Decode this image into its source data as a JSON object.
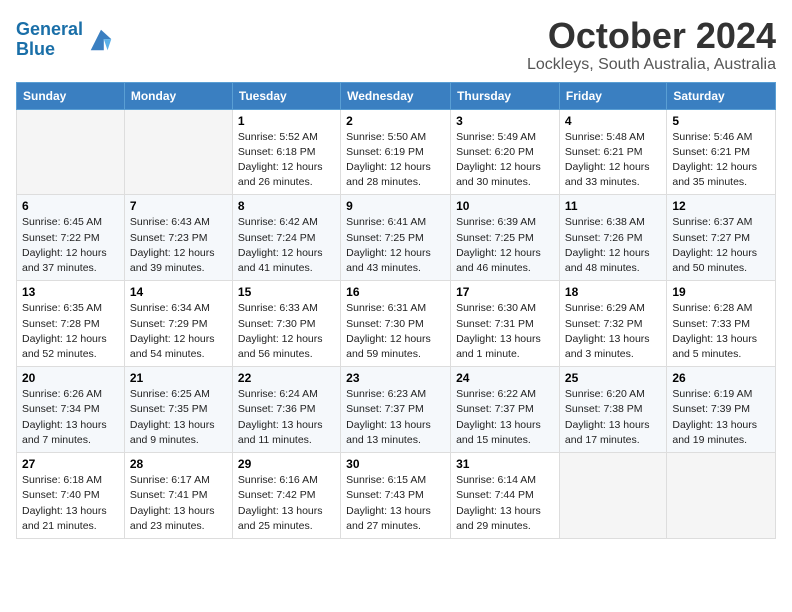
{
  "header": {
    "logo_line1": "General",
    "logo_line2": "Blue",
    "month": "October 2024",
    "location": "Lockleys, South Australia, Australia"
  },
  "days_of_week": [
    "Sunday",
    "Monday",
    "Tuesday",
    "Wednesday",
    "Thursday",
    "Friday",
    "Saturday"
  ],
  "weeks": [
    [
      {
        "day": "",
        "content": ""
      },
      {
        "day": "",
        "content": ""
      },
      {
        "day": "1",
        "content": "Sunrise: 5:52 AM\nSunset: 6:18 PM\nDaylight: 12 hours\nand 26 minutes."
      },
      {
        "day": "2",
        "content": "Sunrise: 5:50 AM\nSunset: 6:19 PM\nDaylight: 12 hours\nand 28 minutes."
      },
      {
        "day": "3",
        "content": "Sunrise: 5:49 AM\nSunset: 6:20 PM\nDaylight: 12 hours\nand 30 minutes."
      },
      {
        "day": "4",
        "content": "Sunrise: 5:48 AM\nSunset: 6:21 PM\nDaylight: 12 hours\nand 33 minutes."
      },
      {
        "day": "5",
        "content": "Sunrise: 5:46 AM\nSunset: 6:21 PM\nDaylight: 12 hours\nand 35 minutes."
      }
    ],
    [
      {
        "day": "6",
        "content": "Sunrise: 6:45 AM\nSunset: 7:22 PM\nDaylight: 12 hours\nand 37 minutes."
      },
      {
        "day": "7",
        "content": "Sunrise: 6:43 AM\nSunset: 7:23 PM\nDaylight: 12 hours\nand 39 minutes."
      },
      {
        "day": "8",
        "content": "Sunrise: 6:42 AM\nSunset: 7:24 PM\nDaylight: 12 hours\nand 41 minutes."
      },
      {
        "day": "9",
        "content": "Sunrise: 6:41 AM\nSunset: 7:25 PM\nDaylight: 12 hours\nand 43 minutes."
      },
      {
        "day": "10",
        "content": "Sunrise: 6:39 AM\nSunset: 7:25 PM\nDaylight: 12 hours\nand 46 minutes."
      },
      {
        "day": "11",
        "content": "Sunrise: 6:38 AM\nSunset: 7:26 PM\nDaylight: 12 hours\nand 48 minutes."
      },
      {
        "day": "12",
        "content": "Sunrise: 6:37 AM\nSunset: 7:27 PM\nDaylight: 12 hours\nand 50 minutes."
      }
    ],
    [
      {
        "day": "13",
        "content": "Sunrise: 6:35 AM\nSunset: 7:28 PM\nDaylight: 12 hours\nand 52 minutes."
      },
      {
        "day": "14",
        "content": "Sunrise: 6:34 AM\nSunset: 7:29 PM\nDaylight: 12 hours\nand 54 minutes."
      },
      {
        "day": "15",
        "content": "Sunrise: 6:33 AM\nSunset: 7:30 PM\nDaylight: 12 hours\nand 56 minutes."
      },
      {
        "day": "16",
        "content": "Sunrise: 6:31 AM\nSunset: 7:30 PM\nDaylight: 12 hours\nand 59 minutes."
      },
      {
        "day": "17",
        "content": "Sunrise: 6:30 AM\nSunset: 7:31 PM\nDaylight: 13 hours\nand 1 minute."
      },
      {
        "day": "18",
        "content": "Sunrise: 6:29 AM\nSunset: 7:32 PM\nDaylight: 13 hours\nand 3 minutes."
      },
      {
        "day": "19",
        "content": "Sunrise: 6:28 AM\nSunset: 7:33 PM\nDaylight: 13 hours\nand 5 minutes."
      }
    ],
    [
      {
        "day": "20",
        "content": "Sunrise: 6:26 AM\nSunset: 7:34 PM\nDaylight: 13 hours\nand 7 minutes."
      },
      {
        "day": "21",
        "content": "Sunrise: 6:25 AM\nSunset: 7:35 PM\nDaylight: 13 hours\nand 9 minutes."
      },
      {
        "day": "22",
        "content": "Sunrise: 6:24 AM\nSunset: 7:36 PM\nDaylight: 13 hours\nand 11 minutes."
      },
      {
        "day": "23",
        "content": "Sunrise: 6:23 AM\nSunset: 7:37 PM\nDaylight: 13 hours\nand 13 minutes."
      },
      {
        "day": "24",
        "content": "Sunrise: 6:22 AM\nSunset: 7:37 PM\nDaylight: 13 hours\nand 15 minutes."
      },
      {
        "day": "25",
        "content": "Sunrise: 6:20 AM\nSunset: 7:38 PM\nDaylight: 13 hours\nand 17 minutes."
      },
      {
        "day": "26",
        "content": "Sunrise: 6:19 AM\nSunset: 7:39 PM\nDaylight: 13 hours\nand 19 minutes."
      }
    ],
    [
      {
        "day": "27",
        "content": "Sunrise: 6:18 AM\nSunset: 7:40 PM\nDaylight: 13 hours\nand 21 minutes."
      },
      {
        "day": "28",
        "content": "Sunrise: 6:17 AM\nSunset: 7:41 PM\nDaylight: 13 hours\nand 23 minutes."
      },
      {
        "day": "29",
        "content": "Sunrise: 6:16 AM\nSunset: 7:42 PM\nDaylight: 13 hours\nand 25 minutes."
      },
      {
        "day": "30",
        "content": "Sunrise: 6:15 AM\nSunset: 7:43 PM\nDaylight: 13 hours\nand 27 minutes."
      },
      {
        "day": "31",
        "content": "Sunrise: 6:14 AM\nSunset: 7:44 PM\nDaylight: 13 hours\nand 29 minutes."
      },
      {
        "day": "",
        "content": ""
      },
      {
        "day": "",
        "content": ""
      }
    ]
  ]
}
